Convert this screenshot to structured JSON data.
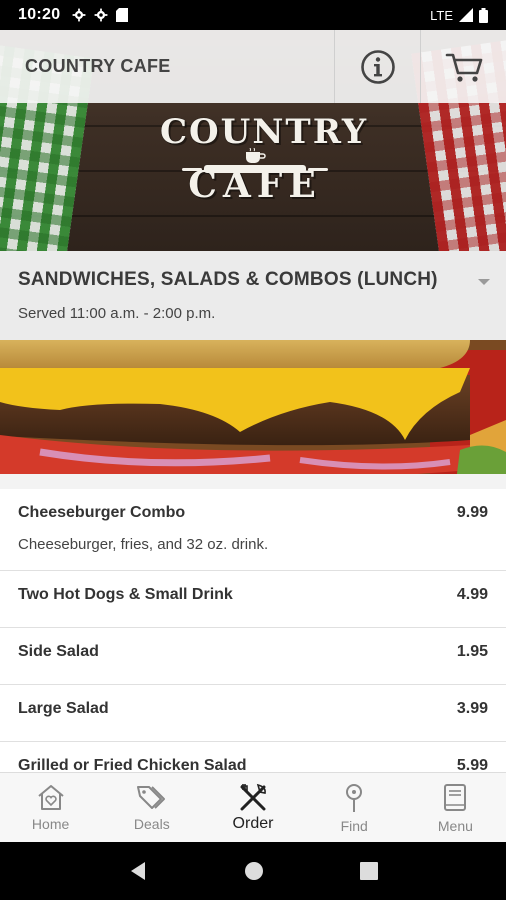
{
  "status_bar": {
    "time": "10:20",
    "network": "LTE"
  },
  "header": {
    "title": "COUNTRY CAFE"
  },
  "logo": {
    "line1": "COUNTRY",
    "line2": "CAFE"
  },
  "section": {
    "title": "SANDWICHES, SALADS & COMBOS (LUNCH)",
    "subtitle": "Served 11:00 a.m. - 2:00 p.m."
  },
  "menu_items": [
    {
      "name": "Cheeseburger Combo",
      "price": "9.99",
      "description": "Cheeseburger, fries, and 32 oz. drink."
    },
    {
      "name": "Two Hot Dogs & Small Drink",
      "price": "4.99"
    },
    {
      "name": "Side Salad",
      "price": "1.95"
    },
    {
      "name": "Large Salad",
      "price": "3.99"
    },
    {
      "name": "Grilled or Fried Chicken Salad",
      "price": "5.99"
    }
  ],
  "tabs": [
    {
      "label": "Home",
      "icon": "home-heart-icon"
    },
    {
      "label": "Deals",
      "icon": "tags-icon"
    },
    {
      "label": "Order",
      "icon": "utensils-icon",
      "active": true
    },
    {
      "label": "Find",
      "icon": "map-pin-icon"
    },
    {
      "label": "Menu",
      "icon": "book-icon"
    }
  ],
  "colors": {
    "header_bg": "#f5f5f5",
    "section_bg": "#ebebeb",
    "text": "#333333",
    "inactive_tab": "#888888"
  }
}
